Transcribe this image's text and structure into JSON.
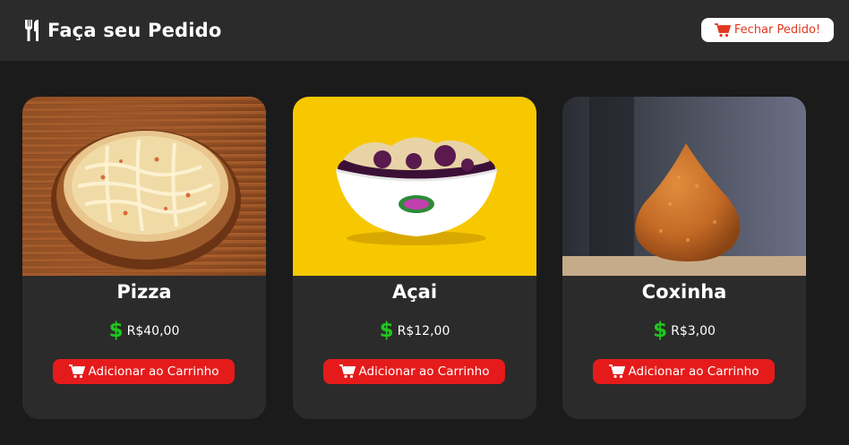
{
  "header": {
    "title": "Faça seu Pedido",
    "brand_icon": "utensils-icon",
    "close_button": {
      "label": "Fechar Pedido!",
      "icon": "cart-icon"
    }
  },
  "colors": {
    "background": "#1b1b1b",
    "header_bg": "#2b2b2b",
    "card_bg": "#2b2b2b",
    "accent_red": "#e51b1b",
    "close_text": "#e0381f",
    "price_green": "#1ec71e"
  },
  "products": [
    {
      "name": "Pizza",
      "currency_icon": "$",
      "price": "R$40,00",
      "button_label": "Adicionar ao Carrinho"
    },
    {
      "name": "Açai",
      "currency_icon": "$",
      "price": "R$12,00",
      "button_label": "Adicionar ao Carrinho"
    },
    {
      "name": "Coxinha",
      "currency_icon": "$",
      "price": "R$3,00",
      "button_label": "Adicionar ao Carrinho"
    }
  ]
}
